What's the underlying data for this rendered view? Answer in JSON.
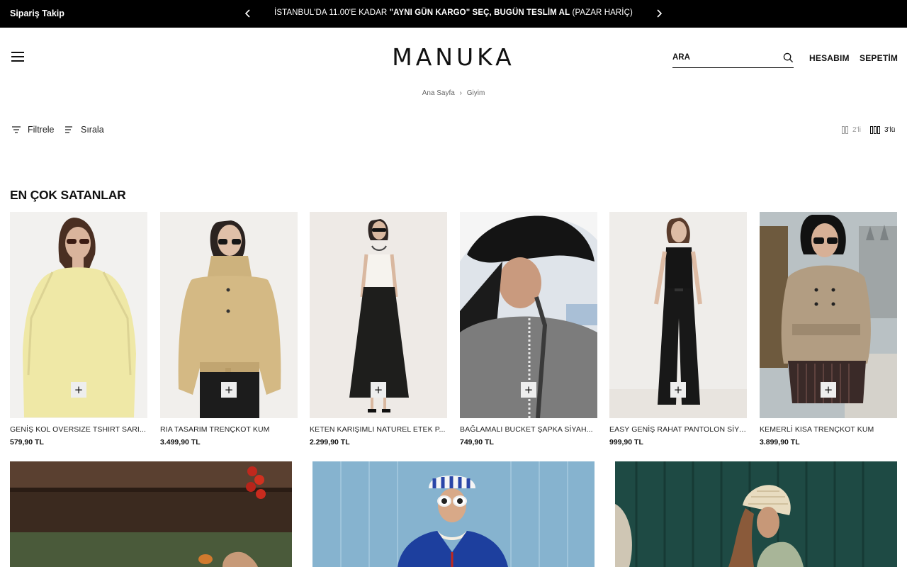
{
  "topbar": {
    "order_tracking": "Sipariş Takip",
    "announcement_prefix": "İSTANBUL'DA 11.00'E KADAR ",
    "announcement_bold": "\"AYNI GÜN KARGO\" SEÇ, BUGÜN TESLİM AL",
    "announcement_suffix": " (PAZAR HARİÇ)"
  },
  "header": {
    "logo": "MANUKA",
    "search_placeholder": "ARA",
    "account_label": "HESABIM",
    "cart_label": "SEPETİM"
  },
  "breadcrumb": {
    "home": "Ana Sayfa",
    "current": "Giyim"
  },
  "toolbar": {
    "filter_label": "Filtrele",
    "sort_label": "Sırala",
    "grid_two_label": "2'li",
    "grid_three_label": "3'lü"
  },
  "section_title": "EN ÇOK SATANLAR",
  "products": [
    {
      "name": "GENİŞ KOL OVERSIZE TSHIRT SARI...",
      "price": "579,90 TL",
      "add_label": "+"
    },
    {
      "name": "RIA TASARIM TRENÇKOT KUM",
      "price": "3.499,90 TL",
      "add_label": "+"
    },
    {
      "name": "KETEN KARIŞIMLI NATUREL ETEK P...",
      "price": "2.299,90 TL",
      "add_label": "+"
    },
    {
      "name": "BAĞLAMALI BUCKET ŞAPKA SİYAH...",
      "price": "749,90 TL",
      "add_label": "+"
    },
    {
      "name": "EASY GENİŞ RAHAT PANTOLON SİYA...",
      "price": "999,90 TL",
      "add_label": "+"
    },
    {
      "name": "KEMERLİ KISA TRENÇKOT KUM",
      "price": "3.899,90 TL",
      "add_label": "+"
    }
  ],
  "colors": {
    "topbar_bg": "#000000",
    "text": "#111111",
    "accent": "#111111"
  }
}
